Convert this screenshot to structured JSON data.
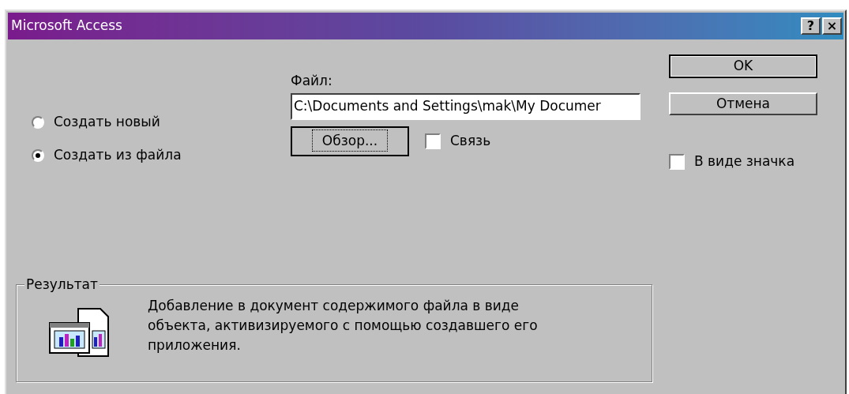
{
  "window": {
    "title": "Microsoft Access",
    "title_buttons": [
      "?",
      "×"
    ]
  },
  "options": [
    {
      "label": "Создать новый",
      "selected": false
    },
    {
      "label": "Создать из файла",
      "selected": true
    }
  ],
  "file": {
    "label": "Файл:",
    "value": "C:\\Documents and Settings\\mak\\My Documer"
  },
  "browse_button": "Обзор...",
  "link": {
    "label": "Связь",
    "checked": false
  },
  "buttons": [
    "OK",
    "Отмена"
  ],
  "as_icon": {
    "label": "В виде значка",
    "checked": false
  },
  "result": {
    "title": "Результат",
    "text": "Добавление в документ содержимого файла в виде объекта, активизируемого с помощью создавшего его приложения."
  }
}
